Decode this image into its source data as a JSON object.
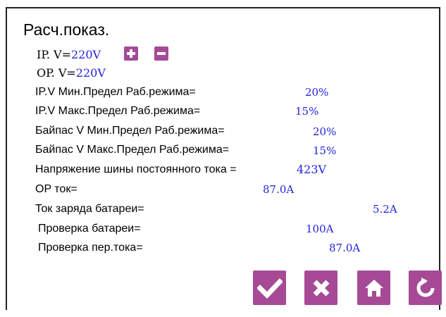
{
  "title": "Расч.показ.",
  "ip_v": {
    "prefix": "IP. V=",
    "value": "220V"
  },
  "op_v": {
    "prefix": "OP. V=",
    "value": "220V"
  },
  "rows": [
    {
      "label": "IP.V Мин.Предел Раб.режима=",
      "value": "20%"
    },
    {
      "label": "IP.V Макс.Предел Раб.режима=",
      "value": "15%"
    },
    {
      "label": "Байпас V Мин.Предел Раб.режима=",
      "value": "20%"
    },
    {
      "label": "Байпас V Макс.Предел Раб.режима=",
      "value": "15%"
    },
    {
      "label": "Напряжение шины постоянного тока =",
      "value": "423V"
    },
    {
      "label": "OP ток=",
      "value": "87.0A"
    },
    {
      "label": "Ток заряда батареи=",
      "value": "5.2A"
    },
    {
      "label": "Проверка батареи=",
      "value": "100A"
    },
    {
      "label": "Проверка пер.тока=",
      "value": "87.0A"
    }
  ],
  "colors": {
    "accent": "#a64a96",
    "value": "#1f1fe0"
  },
  "buttons": [
    "check-icon",
    "close-icon",
    "home-icon",
    "refresh-icon"
  ]
}
